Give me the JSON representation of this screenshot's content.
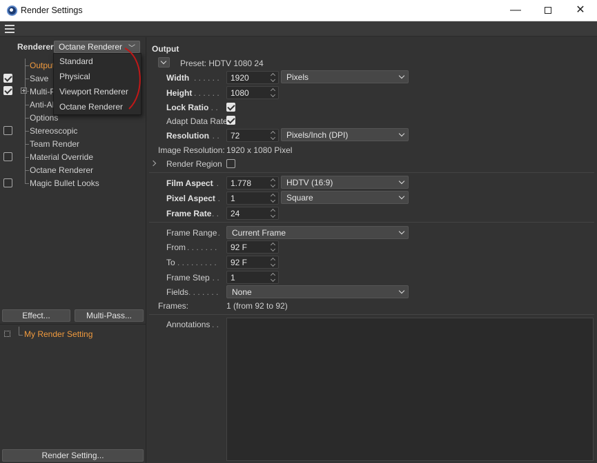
{
  "window": {
    "title": "Render Settings",
    "min_glyph": "—",
    "close_glyph": "✕"
  },
  "renderer": {
    "label": "Renderer",
    "selected": "Octane Renderer"
  },
  "renderer_popup": [
    "Standard",
    "Physical",
    "Viewport Renderer",
    "Octane Renderer"
  ],
  "tree": [
    "Output",
    "Save",
    "Multi-Pass",
    "Anti-Aliasing",
    "Options",
    "Stereoscopic",
    "Team Render",
    "Material Override",
    "Octane Renderer",
    "Magic Bullet Looks"
  ],
  "tree_visible": [
    "Output",
    "Save",
    "Multi-P",
    "Anti-Al",
    "Options",
    "Stereoscopic",
    "Team Render",
    "Material Override",
    "Octane Renderer",
    "Magic Bullet Looks"
  ],
  "buttons": {
    "effect": "Effect...",
    "multipass": "Multi-Pass...",
    "render_setting": "Render Setting..."
  },
  "render_setting_item": "My Render Setting",
  "output": {
    "section": "Output",
    "preset": "Preset: HDTV 1080 24",
    "width_label": "Width",
    "width": "1920",
    "width_unit": "Pixels",
    "height_label": "Height",
    "height": "1080",
    "lock_ratio_label": "Lock Ratio",
    "adapt_label": "Adapt Data Rate",
    "resolution_label": "Resolution",
    "resolution": "72",
    "resolution_unit": "Pixels/Inch (DPI)",
    "image_res_label": "Image Resolution:",
    "image_res": "1920 x 1080 Pixel",
    "region_label": "Render Region",
    "film_aspect_label": "Film Aspect",
    "film_aspect": "1.778",
    "film_aspect_preset": "HDTV (16:9)",
    "pixel_aspect_label": "Pixel Aspect",
    "pixel_aspect": "1",
    "pixel_aspect_preset": "Square",
    "frame_rate_label": "Frame Rate",
    "frame_rate": "24",
    "frame_range_label": "Frame Range",
    "frame_range": "Current Frame",
    "from_label": "From",
    "from": "92 F",
    "to_label": "To",
    "to": "92 F",
    "frame_step_label": "Frame Step",
    "frame_step": "1",
    "fields_label": "Fields",
    "fields": "None",
    "frames_label": "Frames:",
    "frames": "1 (from 92 to 92)",
    "annotations_label": "Annotations"
  },
  "colors": {
    "accent": "#f09a3e",
    "annotation": "#c01818"
  }
}
